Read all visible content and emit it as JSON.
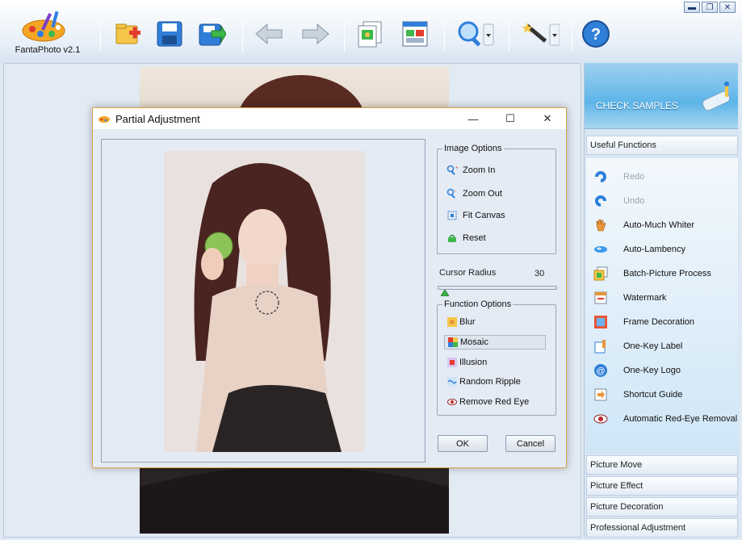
{
  "app": {
    "name": "FantaPhoto v2.1"
  },
  "window_controls": {
    "minimize": "▬",
    "restore": "❐",
    "close": "✕"
  },
  "toolbar": {
    "buttons": [
      {
        "name": "open-icon"
      },
      {
        "name": "save-icon"
      },
      {
        "name": "export-icon"
      },
      {
        "name": "undo-arrow-icon"
      },
      {
        "name": "redo-arrow-icon"
      },
      {
        "name": "batch-icon"
      },
      {
        "name": "view-icon"
      },
      {
        "name": "zoom-icon"
      },
      {
        "name": "magic-wand-icon"
      },
      {
        "name": "help-icon"
      }
    ],
    "help_label": "?"
  },
  "right_panel": {
    "check_samples": "CHECK SAMPLES",
    "useful_functions": "Useful Functions",
    "items": [
      {
        "label": "Redo",
        "icon": "redo-icon",
        "disabled": true
      },
      {
        "label": "Undo",
        "icon": "undo-icon",
        "disabled": true
      },
      {
        "label": "Auto-Much Whiter",
        "icon": "hand-icon"
      },
      {
        "label": "Auto-Lambency",
        "icon": "lambency-icon"
      },
      {
        "label": "Batch-Picture Process",
        "icon": "batch-icon"
      },
      {
        "label": "Watermark",
        "icon": "watermark-icon"
      },
      {
        "label": "Frame Decoration",
        "icon": "frame-icon"
      },
      {
        "label": "One-Key Label",
        "icon": "label-icon"
      },
      {
        "label": "One-Key Logo",
        "icon": "logo-icon"
      },
      {
        "label": "Shortcut Guide",
        "icon": "shortcut-icon"
      },
      {
        "label": "Automatic Red-Eye Removal",
        "icon": "eye-icon"
      }
    ],
    "sections": [
      "Picture Move",
      "Picture Effect",
      "Picture Decoration",
      "Professional Adjustment"
    ]
  },
  "dialog": {
    "title": "Partial Adjustment",
    "controls": {
      "minimize": "—",
      "maximize": "☐",
      "close": "✕"
    },
    "image_options": {
      "label": "Image Options",
      "items": [
        "Zoom In",
        "Zoom Out",
        "Fit Canvas",
        "Reset"
      ]
    },
    "cursor_radius": {
      "label": "Cursor Radius",
      "value": "30"
    },
    "function_options": {
      "label": "Function Options",
      "items": [
        "Blur",
        "Mosaic",
        "Illusion",
        "Random Ripple",
        "Remove Red Eye"
      ],
      "selected": "Mosaic"
    },
    "ok": "OK",
    "cancel": "Cancel"
  },
  "colors": {
    "accent": "#2b6cb8",
    "dialog_border": "#d9a54a",
    "panel_bg": "#d9e6f2"
  }
}
